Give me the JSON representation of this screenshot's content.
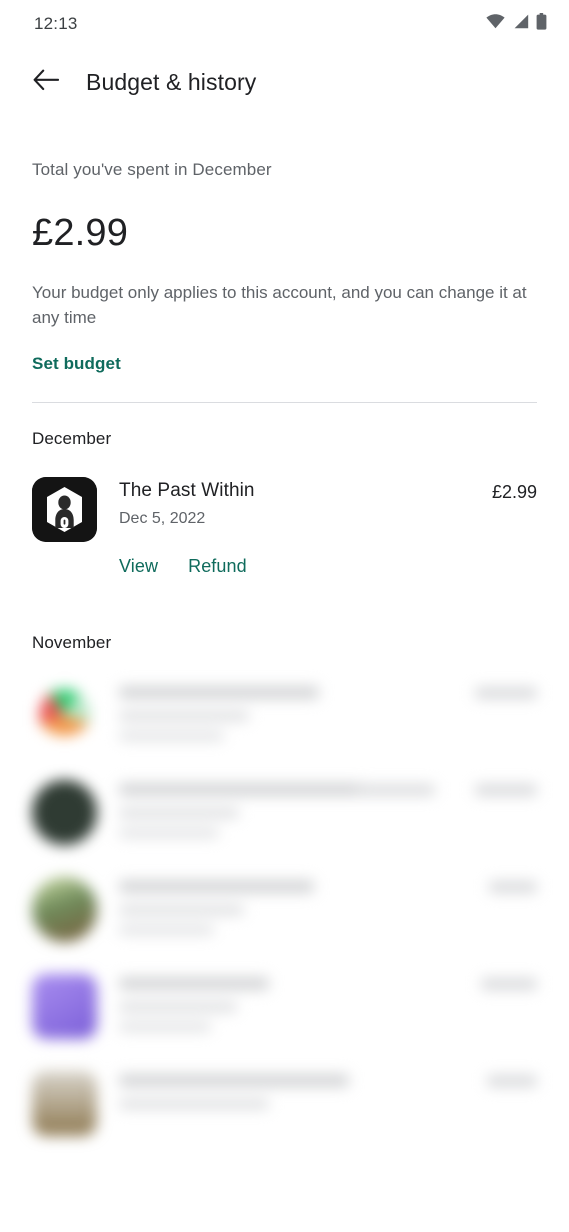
{
  "statusbar": {
    "time": "12:13",
    "icons": [
      "wifi-icon",
      "cellular-signal-icon",
      "battery-icon"
    ]
  },
  "appbar": {
    "back_icon": "back-arrow-icon",
    "title": "Budget & history"
  },
  "summary": {
    "label": "Total you've spent in December",
    "amount": "£2.99",
    "note": "Your budget only applies to this account, and you can change it at any time",
    "set_budget_label": "Set budget"
  },
  "colors": {
    "accent_green": "#0f6b5c",
    "primary_text": "#202124",
    "secondary_text": "#5f6368",
    "divider": "#dadce0"
  },
  "sections": [
    {
      "month": "December",
      "transactions": [
        {
          "title": "The Past Within",
          "date": "Dec 5, 2022",
          "price": "£2.99",
          "icon": "the-past-within-app-icon",
          "actions": [
            "View",
            "Refund"
          ]
        }
      ]
    },
    {
      "month": "November",
      "transactions": []
    }
  ],
  "obscured_rows": [
    {
      "icon_color": "#b9e7c8",
      "note": "content hidden"
    },
    {
      "icon_color": "#2f3b33",
      "note": "content hidden"
    },
    {
      "icon_color": "#8a7a52",
      "note": "content hidden"
    },
    {
      "icon_color": "#8b6fe0",
      "note": "content hidden"
    },
    {
      "icon_color": "#b09a72",
      "note": "content hidden"
    }
  ]
}
